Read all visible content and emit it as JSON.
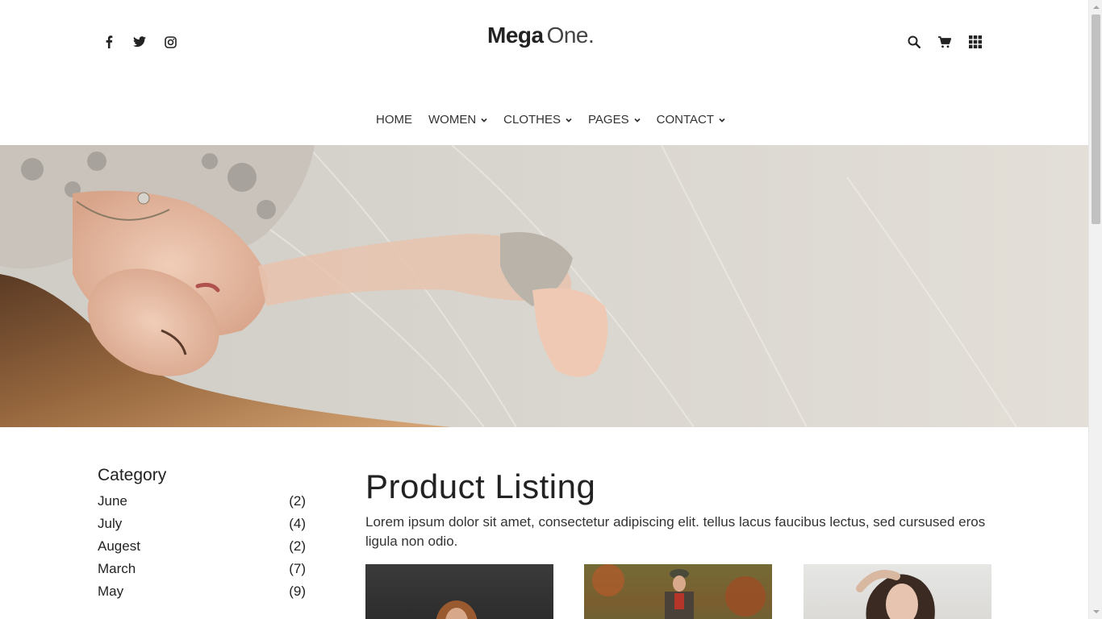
{
  "header": {
    "logo": {
      "bold": "Mega",
      "light": "One."
    },
    "social": [
      {
        "icon": "facebook-icon"
      },
      {
        "icon": "twitter-icon"
      },
      {
        "icon": "instagram-icon"
      }
    ],
    "tools": [
      {
        "icon": "search-icon"
      },
      {
        "icon": "cart-icon"
      },
      {
        "icon": "grid-menu-icon"
      }
    ]
  },
  "nav": {
    "items": [
      {
        "label": "HOME",
        "dropdown": false
      },
      {
        "label": "WOMEN",
        "dropdown": true
      },
      {
        "label": "CLOTHES",
        "dropdown": true
      },
      {
        "label": "PAGES",
        "dropdown": true
      },
      {
        "label": "CONTACT",
        "dropdown": true
      }
    ]
  },
  "sidebar": {
    "title": "Category",
    "items": [
      {
        "label": "June",
        "count": "(2)"
      },
      {
        "label": "July",
        "count": "(4)"
      },
      {
        "label": "Augest",
        "count": "(2)"
      },
      {
        "label": "March",
        "count": "(7)"
      },
      {
        "label": "May",
        "count": "(9)"
      }
    ]
  },
  "main": {
    "title": "Product Listing",
    "description": "Lorem ipsum dolor sit amet, consectetur adipiscing elit. tellus lacus faucibus lectus, sed cursused eros ligula non odio."
  },
  "colors": {
    "text": "#222222",
    "hero_bg": "#ddd9d2"
  }
}
